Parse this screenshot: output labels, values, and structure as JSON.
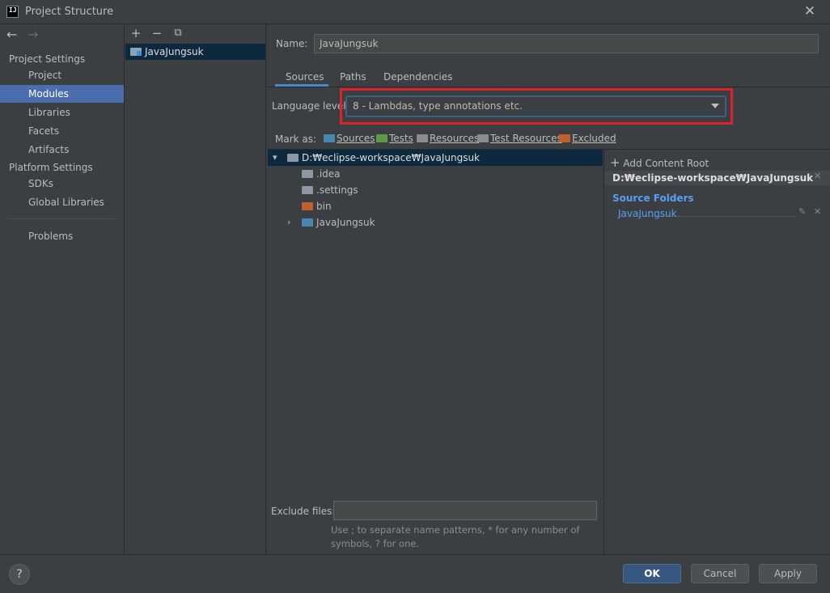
{
  "window": {
    "title": "Project Structure",
    "app_icon_text": "IJ"
  },
  "sidebar": {
    "back_icon": "arrow-left-icon",
    "forward_icon": "arrow-right-icon",
    "project_settings_header": "Project Settings",
    "project_items": [
      "Project",
      "Modules",
      "Libraries",
      "Facets",
      "Artifacts"
    ],
    "platform_settings_header": "Platform Settings",
    "platform_items": [
      "SDKs",
      "Global Libraries"
    ],
    "problems": "Problems",
    "selected": "Modules"
  },
  "modules": {
    "toolbar": [
      "+",
      "−",
      "⧉"
    ],
    "items": [
      "JavaJungsuk"
    ]
  },
  "detail": {
    "name_label": "Name:",
    "name_value": "JavaJungsuk",
    "tabs": [
      "Sources",
      "Paths",
      "Dependencies"
    ],
    "active_tab": "Sources",
    "language_level_label": "Language level:",
    "language_level_value": "8 - Lambdas, type annotations etc.",
    "mark_as_label": "Mark as:",
    "mark_as": [
      "Sources",
      "Tests",
      "Resources",
      "Test Resources",
      "Excluded"
    ],
    "tree": {
      "root": "D:₩eclipse-workspace₩JavaJungsuk",
      "children": [
        ".idea",
        ".settings",
        "bin",
        "JavaJungsuk"
      ]
    },
    "exclude_label": "Exclude files:",
    "exclude_value": "",
    "exclude_hint": "Use ; to separate name patterns, * for any number of symbols, ? for one."
  },
  "content_root": {
    "add_label": "Add Content Root",
    "path": "D:₩eclipse-workspace₩JavaJungsuk",
    "source_folders_header": "Source Folders",
    "source_folders": [
      "JavaJungsuk"
    ]
  },
  "footer": {
    "help": "?",
    "ok": "OK",
    "cancel": "Cancel",
    "apply": "Apply"
  },
  "colors": {
    "background": "#3c3f41",
    "selection": "#4b6eaf",
    "tree_selection": "#0d293e",
    "accent_link": "#589df6",
    "highlight_box": "#e0202a"
  }
}
